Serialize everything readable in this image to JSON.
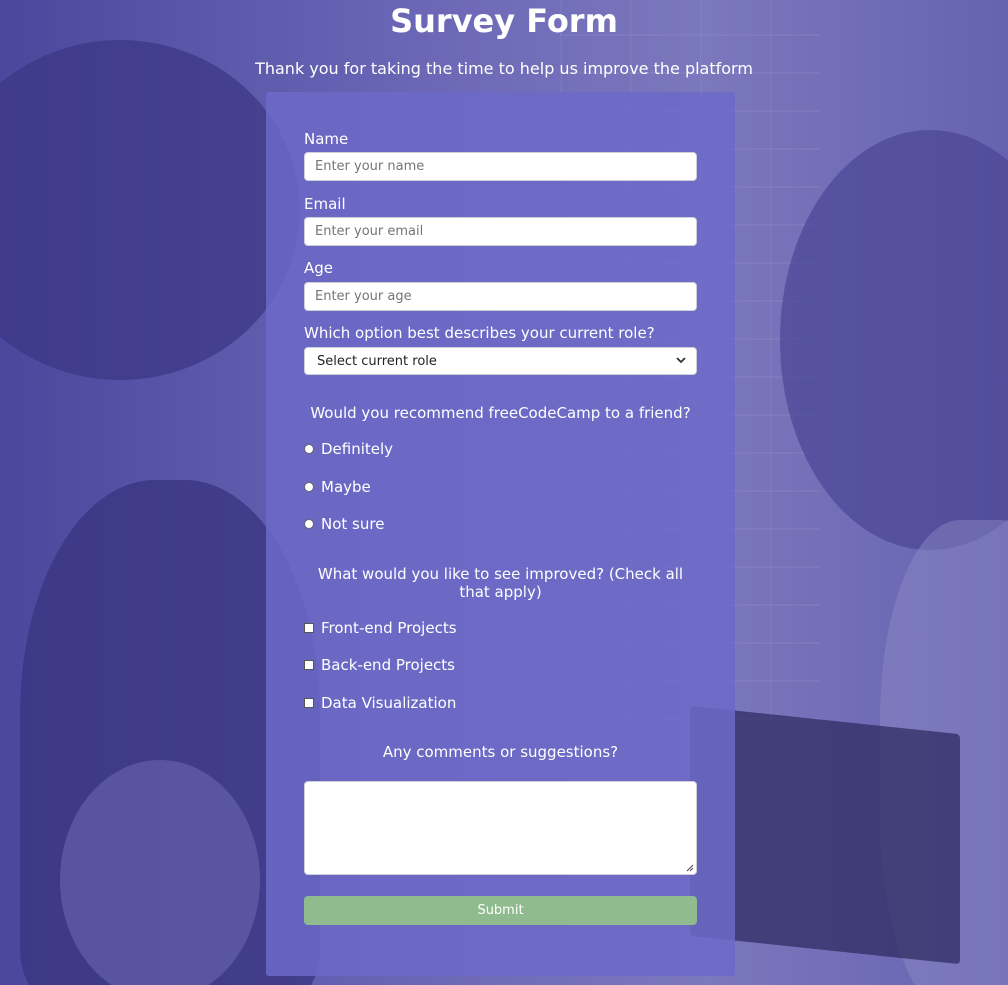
{
  "page": {
    "title": "Survey Form",
    "description": "Thank you for taking the time to help us improve the platform"
  },
  "form": {
    "name": {
      "label": "Name",
      "placeholder": "Enter your name"
    },
    "email": {
      "label": "Email",
      "placeholder": "Enter your email"
    },
    "age": {
      "label": "Age",
      "placeholder": "Enter your age"
    },
    "role": {
      "label": "Which option best describes your current role?",
      "selected": "Select current role"
    },
    "recommend": {
      "question": "Would you recommend freeCodeCamp to a friend?",
      "options": [
        "Definitely",
        "Maybe",
        "Not sure"
      ]
    },
    "improve": {
      "question": "What would you like to see improved? (Check all that apply)",
      "options": [
        "Front-end Projects",
        "Back-end Projects",
        "Data Visualization"
      ]
    },
    "comments": {
      "question": "Any comments or suggestions?"
    },
    "submit_label": "Submit"
  },
  "colors": {
    "card": "#6c6ac8",
    "submit": "#8fbb8e",
    "text": "#ffffff"
  }
}
